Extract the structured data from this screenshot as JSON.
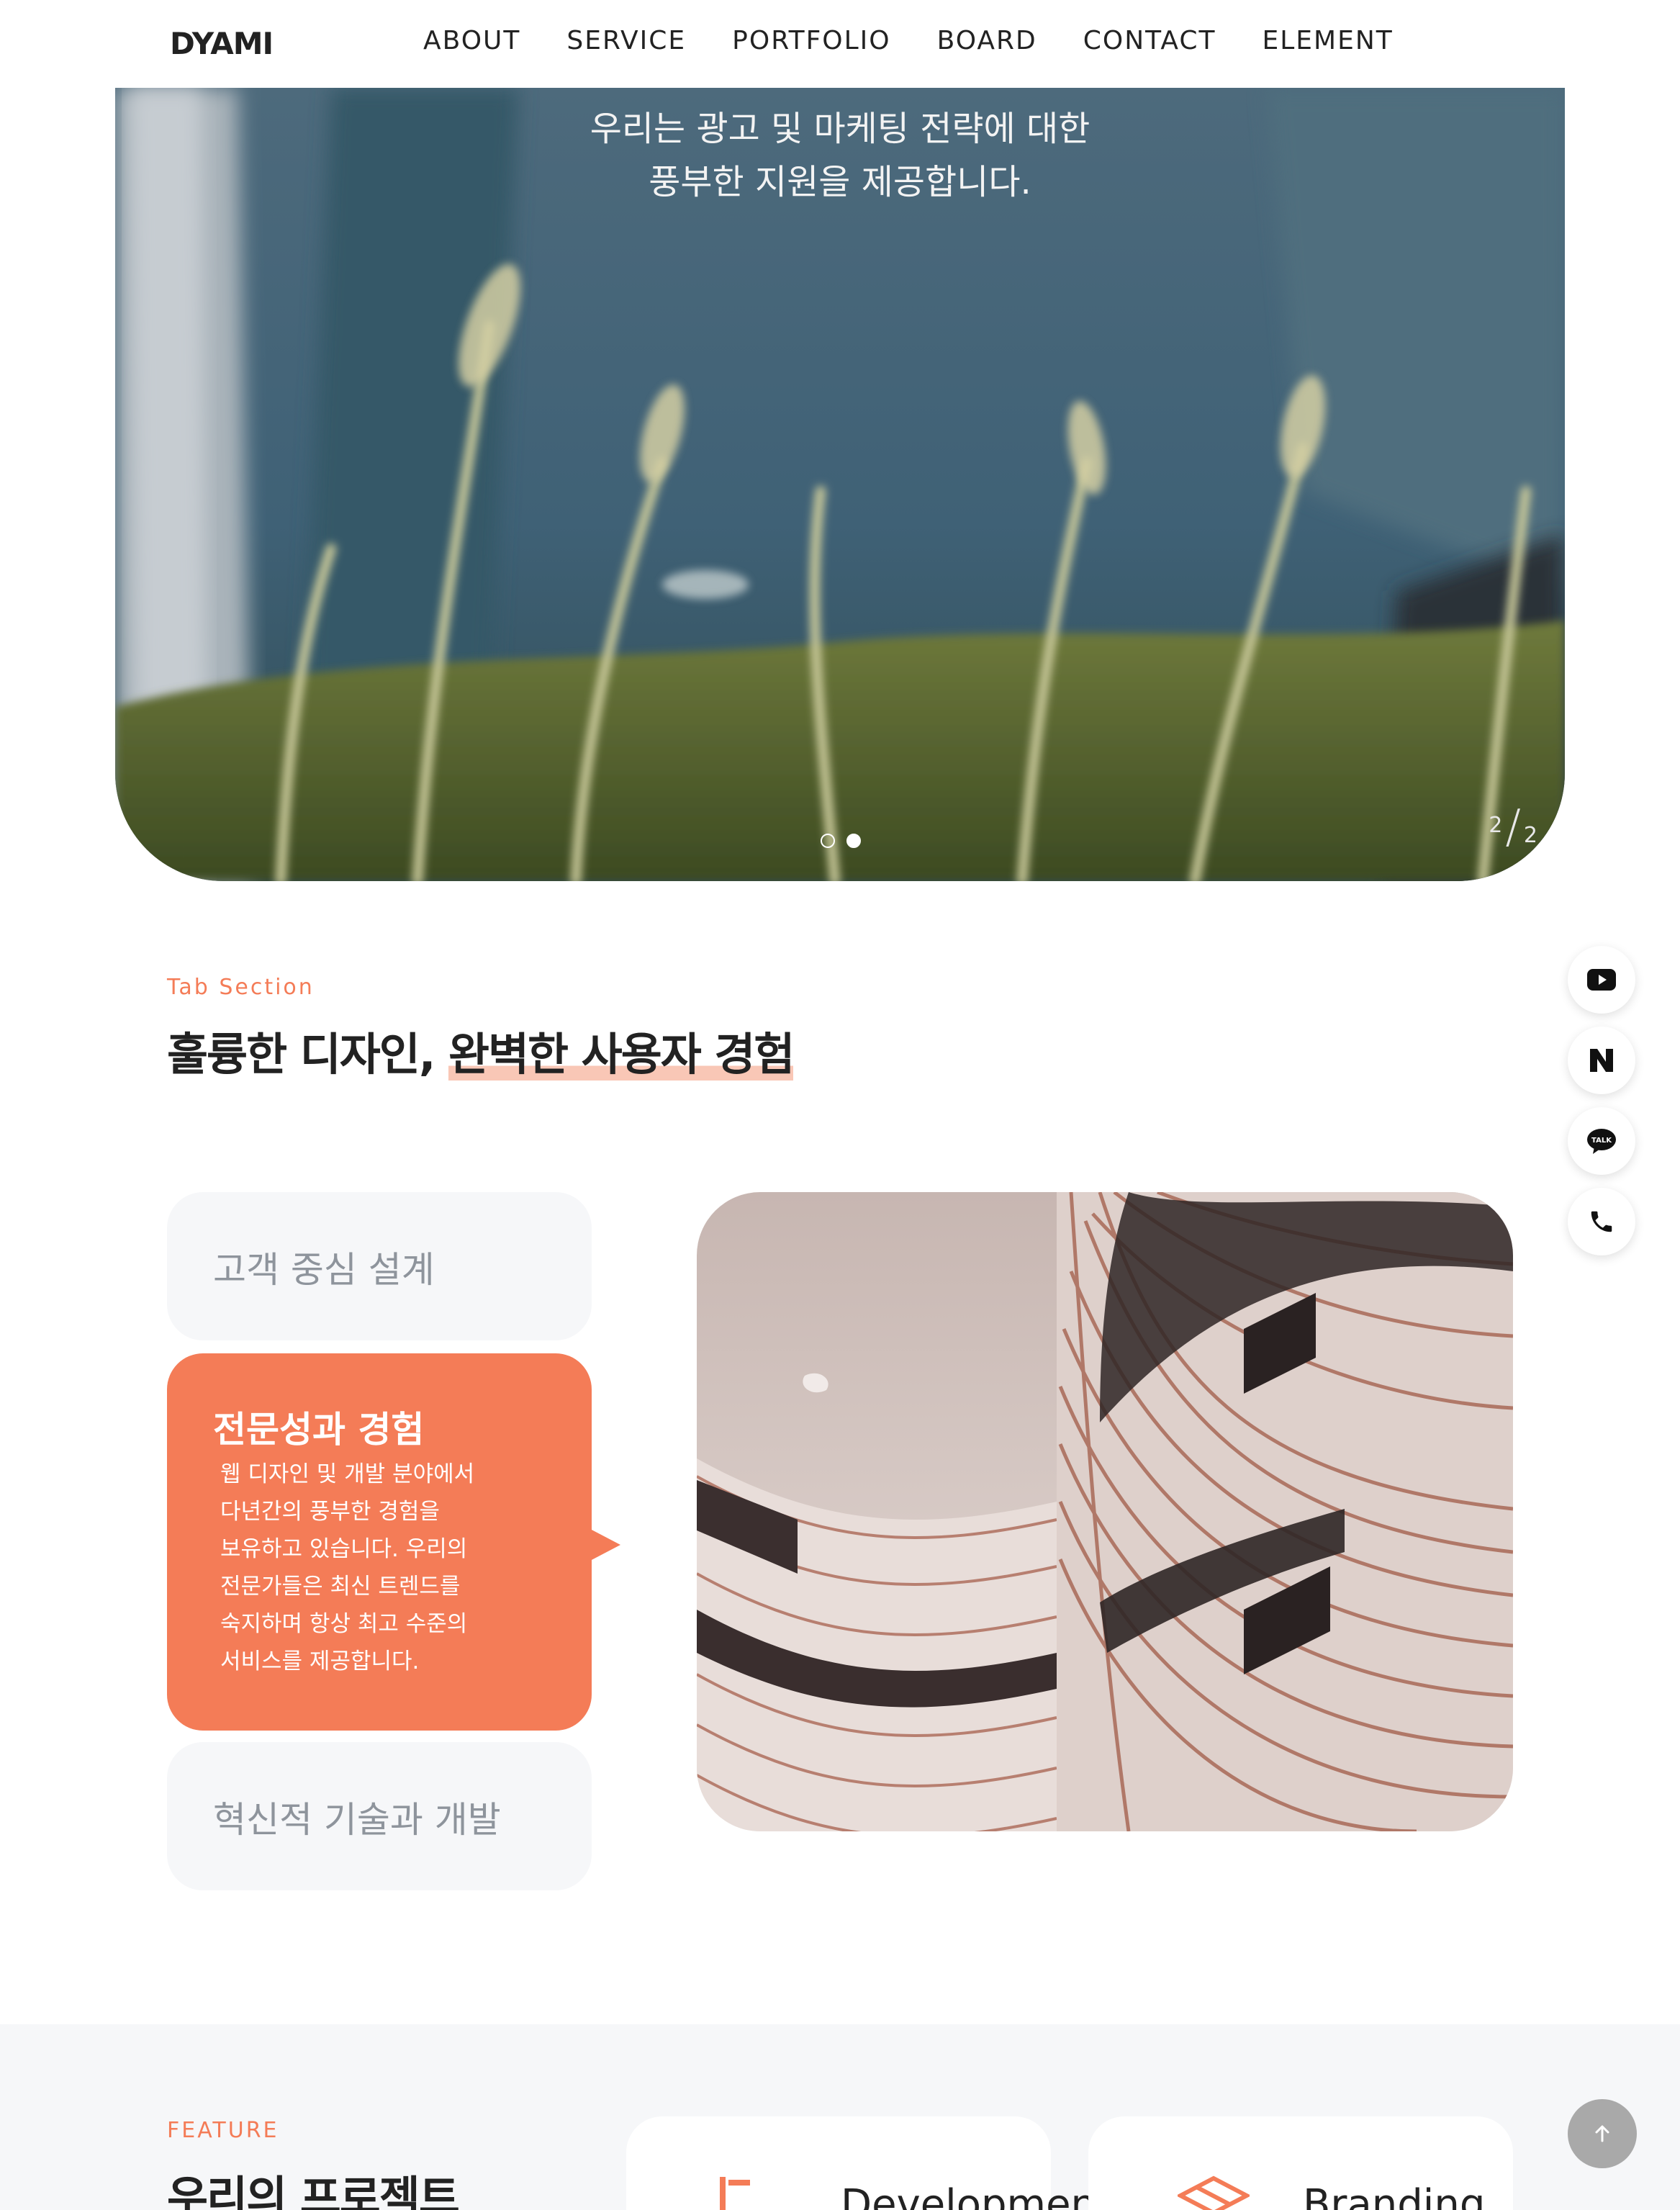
{
  "header": {
    "logo": "DYAMI",
    "nav": [
      {
        "label": "ABOUT"
      },
      {
        "label": "SERVICE"
      },
      {
        "label": "PORTFOLIO"
      },
      {
        "label": "BOARD"
      },
      {
        "label": "CONTACT"
      },
      {
        "label": "ELEMENT"
      }
    ]
  },
  "hero": {
    "text_line1": "우리는 광고 및 마케팅 전략에 대한",
    "text_line2": "풍부한 지원을 제공합니다.",
    "slide_current": "2",
    "slide_total": "2",
    "slide_count": 2,
    "active_slide_index": 1
  },
  "tab_section": {
    "eyebrow": "Tab Section",
    "title_plain": "훌륭한 디자인, ",
    "title_highlight": "완벽한 사용자 경험",
    "tabs": [
      {
        "title": "고객 중심 설계",
        "active": false
      },
      {
        "title": "전문성과 경험",
        "active": true,
        "description_lines": [
          "웹 디자인 및 개발 분야에서",
          "다년간의 풍부한 경험을",
          "보유하고 있습니다. 우리의",
          "전문가들은 최신 트렌드를",
          "숙지하며 항상 최고 수준의",
          "서비스를 제공합니다."
        ]
      },
      {
        "title": "혁신적 기술과 개발",
        "active": false
      }
    ]
  },
  "quick_menu": [
    {
      "icon": "youtube-icon"
    },
    {
      "icon": "naver-blog-icon"
    },
    {
      "icon": "kakaotalk-icon",
      "label": "TALK"
    },
    {
      "icon": "phone-icon"
    }
  ],
  "feature": {
    "eyebrow": "FEATURE",
    "title": "우리의 프로젝트",
    "cards": [
      {
        "title": "Development",
        "icon": "development-icon"
      },
      {
        "title": "Branding",
        "icon": "branding-icon"
      }
    ]
  },
  "colors": {
    "accent": "#f47c57",
    "highlight": "#f9c7b6",
    "card_bg": "#f6f7f9",
    "text_dark": "#222222",
    "text_muted": "#8e949c"
  }
}
